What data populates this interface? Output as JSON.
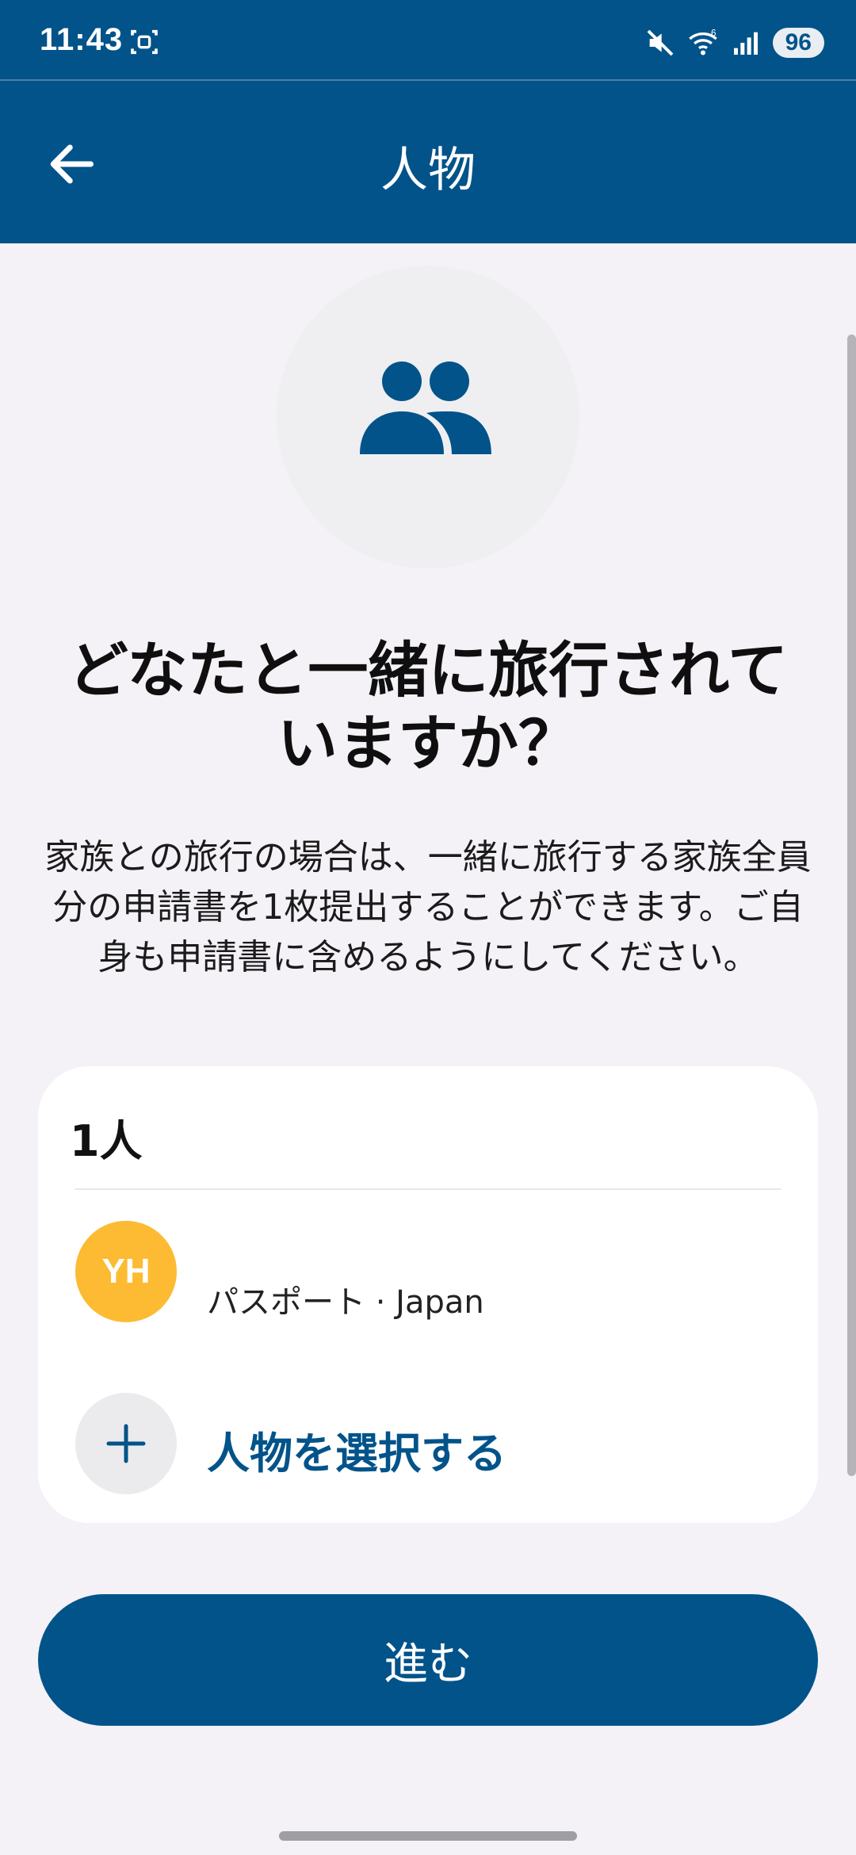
{
  "status_bar": {
    "time": "11:43",
    "icons": [
      "screenshot-capture-icon",
      "mute-icon",
      "wifi-icon",
      "signal-icon"
    ],
    "wifi_badge": "6",
    "battery": "96"
  },
  "app_bar": {
    "back_icon": "arrow-left-icon",
    "title": "人物"
  },
  "hero": {
    "icon": "group-people-icon"
  },
  "headline": "どなたと一緒に旅行されていますか？",
  "description": "家族との旅行の場合は、一緒に旅行する家族全員分の申請書を1枚提出することができます。ご自身も申請書に含めるようにしてください。",
  "card": {
    "count_label": "1人",
    "people": [
      {
        "initials": "YH",
        "document": "パスポート · Japan"
      }
    ],
    "add_label": "人物を選択する",
    "add_icon": "plus-icon"
  },
  "proceed_button": "進む",
  "colors": {
    "primary": "#02538a",
    "background": "#f4f1f7",
    "avatar": "#fdbb33"
  }
}
